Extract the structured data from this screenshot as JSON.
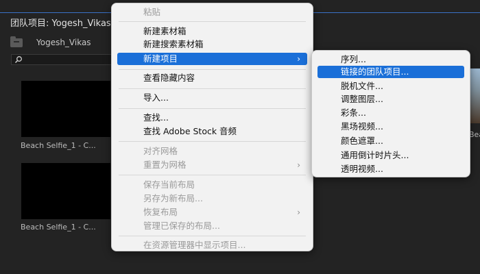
{
  "panel": {
    "title": "团队项目: Yogesh_Vikas",
    "folder_name": "Yogesh_Vikas",
    "accent": "#3a72c9"
  },
  "thumbnails": [
    {
      "label": "Beach Selfie_1 - C..."
    },
    {
      "label": "Beach Selfie_1 - C..."
    }
  ],
  "right_thumb_label": "Beach Selfie",
  "context_menu": {
    "items": [
      {
        "label": "粘贴",
        "disabled": true
      },
      {
        "label": "新建素材箱",
        "disabled": false
      },
      {
        "label": "新建搜索素材箱",
        "disabled": false
      },
      {
        "label": "新建项目",
        "disabled": false,
        "highlighted": true,
        "submenu": true
      },
      {
        "label": "查看隐藏内容",
        "disabled": false
      },
      {
        "label": "导入...",
        "disabled": false
      },
      {
        "label": "查找...",
        "disabled": false
      },
      {
        "label": "查找 Adobe Stock 音频",
        "disabled": false
      },
      {
        "label": "对齐网格",
        "disabled": true
      },
      {
        "label": "重置为网格",
        "disabled": true,
        "submenu": true
      },
      {
        "label": "保存当前布局",
        "disabled": true
      },
      {
        "label": "另存为新布局...",
        "disabled": true
      },
      {
        "label": "恢复布局",
        "disabled": true,
        "submenu": true
      },
      {
        "label": "管理已保存的布局...",
        "disabled": true
      },
      {
        "label": "在资源管理器中显示项目...",
        "disabled": true
      }
    ]
  },
  "submenu": {
    "items": [
      {
        "label": "序列..."
      },
      {
        "label": "链接的团队项目...",
        "highlighted": true
      },
      {
        "label": "脱机文件..."
      },
      {
        "label": "调整图层..."
      },
      {
        "label": "彩条..."
      },
      {
        "label": "黑场视频..."
      },
      {
        "label": "颜色遮罩..."
      },
      {
        "label": "通用倒计时片头..."
      },
      {
        "label": "透明视频..."
      }
    ]
  },
  "colors": {
    "highlight": "#1a6fd8",
    "menu_bg": "#f2f2f2",
    "panel_bg": "#232323"
  },
  "icons": {
    "search": "search-icon",
    "folder": "folder-icon",
    "submenu_arrow": "chevron-right-icon"
  }
}
